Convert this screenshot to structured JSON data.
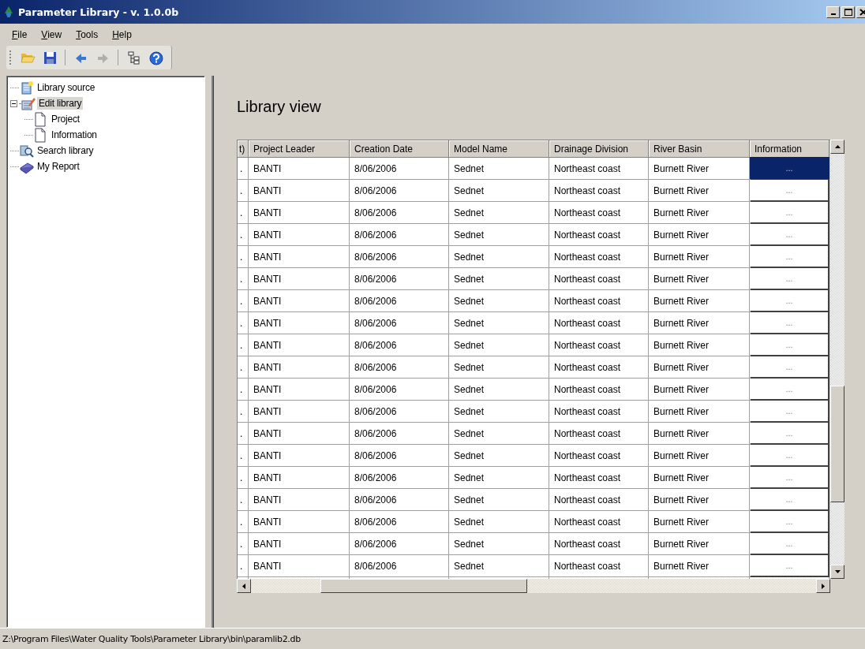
{
  "window": {
    "title": "Parameter Library - v. 1.0.0b"
  },
  "menu": [
    "File",
    "View",
    "Tools",
    "Help"
  ],
  "toolbar": [
    {
      "kind": "open",
      "disabled": false
    },
    {
      "kind": "save",
      "disabled": false
    },
    {
      "kind": "sep"
    },
    {
      "kind": "back",
      "disabled": false
    },
    {
      "kind": "forward",
      "disabled": true
    },
    {
      "kind": "sep"
    },
    {
      "kind": "tree",
      "disabled": false
    },
    {
      "kind": "help",
      "disabled": false
    }
  ],
  "tree": [
    {
      "label": "Library source",
      "kind": "source",
      "selected": false
    },
    {
      "label": "Edit library",
      "kind": "edit",
      "selected": true,
      "expanded": true,
      "children": [
        {
          "label": "Project",
          "kind": "page",
          "selected": false
        },
        {
          "label": "Information",
          "kind": "page",
          "selected": false
        }
      ]
    },
    {
      "label": "Search library",
      "kind": "search",
      "selected": false
    },
    {
      "label": "My Report",
      "kind": "report",
      "selected": false
    }
  ],
  "view": {
    "title": "Library view"
  },
  "table": {
    "columns": [
      "t)",
      "Project Leader",
      "Creation Date",
      "Model Name",
      "Drainage Division",
      "River Basin",
      "Information"
    ],
    "rows": [
      {
        "cells": [
          ".",
          "BANTI",
          "8/06/2006",
          "Sednet",
          "Northeast coast",
          "Burnett River",
          "..."
        ],
        "selected": true
      },
      {
        "cells": [
          ".",
          "BANTI",
          "8/06/2006",
          "Sednet",
          "Northeast coast",
          "Burnett River",
          "..."
        ],
        "selected": false
      },
      {
        "cells": [
          ".",
          "BANTI",
          "8/06/2006",
          "Sednet",
          "Northeast coast",
          "Burnett River",
          "..."
        ],
        "selected": false
      },
      {
        "cells": [
          ".",
          "BANTI",
          "8/06/2006",
          "Sednet",
          "Northeast coast",
          "Burnett River",
          "..."
        ],
        "selected": false
      },
      {
        "cells": [
          ".",
          "BANTI",
          "8/06/2006",
          "Sednet",
          "Northeast coast",
          "Burnett River",
          "..."
        ],
        "selected": false
      },
      {
        "cells": [
          ".",
          "BANTI",
          "8/06/2006",
          "Sednet",
          "Northeast coast",
          "Burnett River",
          "..."
        ],
        "selected": false
      },
      {
        "cells": [
          ".",
          "BANTI",
          "8/06/2006",
          "Sednet",
          "Northeast coast",
          "Burnett River",
          "..."
        ],
        "selected": false
      },
      {
        "cells": [
          ".",
          "BANTI",
          "8/06/2006",
          "Sednet",
          "Northeast coast",
          "Burnett River",
          "..."
        ],
        "selected": false
      },
      {
        "cells": [
          ".",
          "BANTI",
          "8/06/2006",
          "Sednet",
          "Northeast coast",
          "Burnett River",
          "..."
        ],
        "selected": false
      },
      {
        "cells": [
          ".",
          "BANTI",
          "8/06/2006",
          "Sednet",
          "Northeast coast",
          "Burnett River",
          "..."
        ],
        "selected": false
      },
      {
        "cells": [
          ".",
          "BANTI",
          "8/06/2006",
          "Sednet",
          "Northeast coast",
          "Burnett River",
          "..."
        ],
        "selected": false
      },
      {
        "cells": [
          ".",
          "BANTI",
          "8/06/2006",
          "Sednet",
          "Northeast coast",
          "Burnett River",
          "..."
        ],
        "selected": false
      },
      {
        "cells": [
          ".",
          "BANTI",
          "8/06/2006",
          "Sednet",
          "Northeast coast",
          "Burnett River",
          "..."
        ],
        "selected": false
      },
      {
        "cells": [
          ".",
          "BANTI",
          "8/06/2006",
          "Sednet",
          "Northeast coast",
          "Burnett River",
          "..."
        ],
        "selected": false
      },
      {
        "cells": [
          ".",
          "BANTI",
          "8/06/2006",
          "Sednet",
          "Northeast coast",
          "Burnett River",
          "..."
        ],
        "selected": false
      },
      {
        "cells": [
          ".",
          "BANTI",
          "8/06/2006",
          "Sednet",
          "Northeast coast",
          "Burnett River",
          "..."
        ],
        "selected": false
      },
      {
        "cells": [
          ".",
          "BANTI",
          "8/06/2006",
          "Sednet",
          "Northeast coast",
          "Burnett River",
          "..."
        ],
        "selected": false
      },
      {
        "cells": [
          ".",
          "BANTI",
          "8/06/2006",
          "Sednet",
          "Northeast coast",
          "Burnett River",
          "..."
        ],
        "selected": false
      },
      {
        "cells": [
          ".",
          "BANTI",
          "8/06/2006",
          "Sednet",
          "Northeast coast",
          "Burnett River",
          "..."
        ],
        "selected": false
      }
    ]
  },
  "status_bar": {
    "path": "Z:\\Program Files\\Water Quality Tools\\Parameter Library\\bin\\paramlib2.db"
  }
}
